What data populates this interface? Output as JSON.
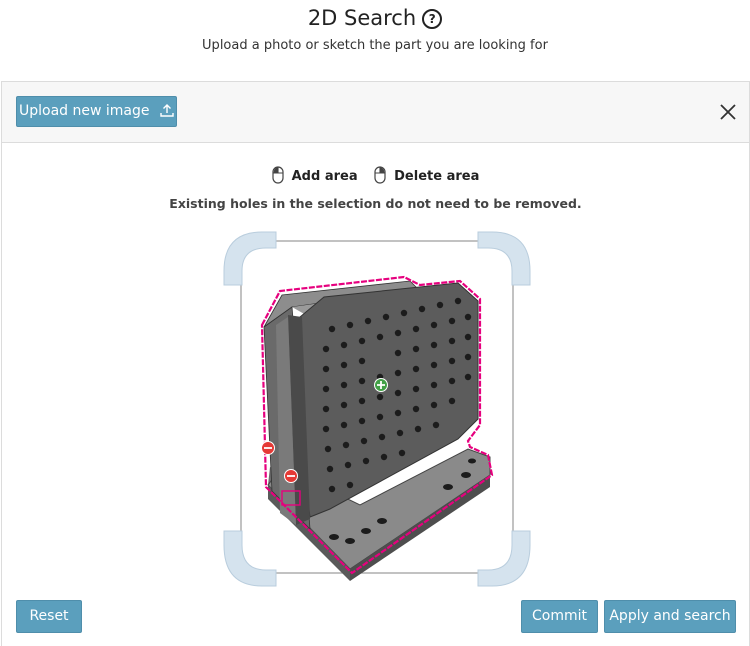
{
  "header": {
    "title": "2D Search",
    "help_icon": "question-circle-icon",
    "subtitle": "Upload a photo or sketch the part you are looking for"
  },
  "toolbar": {
    "upload_label": "Upload new image",
    "upload_icon": "upload-icon",
    "close_icon": "close-icon"
  },
  "legend": {
    "add_label": "Add area",
    "delete_label": "Delete area",
    "add_icon": "mouse-left-icon",
    "delete_icon": "mouse-right-icon"
  },
  "hint": "Existing holes in the selection do not need to be removed.",
  "actions": {
    "reset_label": "Reset",
    "commit_label": "Commit",
    "apply_label": "Apply and search"
  },
  "colors": {
    "button": "#5b9fbd",
    "selection_outline": "#e6007e",
    "delete_marker": "#e53935",
    "add_marker": "#43a047",
    "crop_handle": "#d5e3ee"
  }
}
